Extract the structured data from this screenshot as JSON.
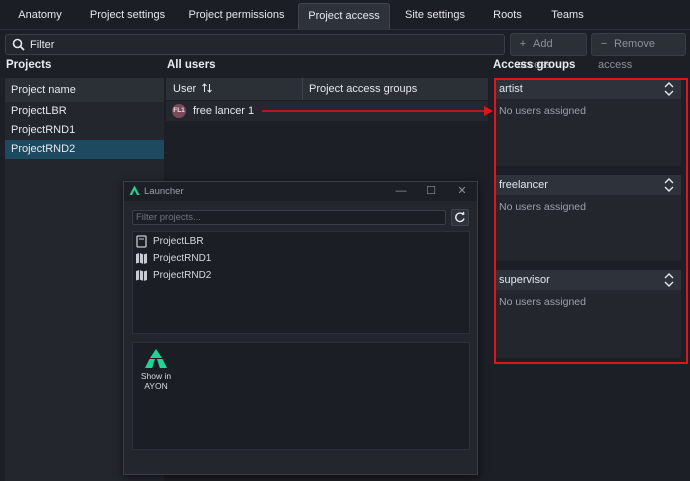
{
  "tabs": [
    {
      "label": "Anatomy"
    },
    {
      "label": "Project settings"
    },
    {
      "label": "Project permissions"
    },
    {
      "label": "Project access",
      "active": true
    },
    {
      "label": "Site settings"
    },
    {
      "label": "Roots"
    },
    {
      "label": "Teams"
    }
  ],
  "filter": {
    "value": "Filter"
  },
  "toolbar": {
    "add_access": "Add access",
    "remove_access": "Remove access"
  },
  "projects": {
    "title": "Projects",
    "column": "Project name",
    "items": [
      "ProjectLBR",
      "ProjectRND1",
      "ProjectRND2"
    ],
    "selected": "ProjectRND2"
  },
  "users": {
    "title": "All users",
    "col_user": "User",
    "col_groups": "Project access groups",
    "rows": [
      {
        "initials": "FL1",
        "name": "free lancer 1"
      }
    ]
  },
  "access_groups": {
    "title": "Access groups",
    "groups": [
      {
        "name": "artist",
        "empty": "No users assigned"
      },
      {
        "name": "freelancer",
        "empty": "No users assigned"
      },
      {
        "name": "supervisor",
        "empty": "No users assigned"
      }
    ]
  },
  "launcher": {
    "title": "Launcher",
    "filter_placeholder": "Filter projects...",
    "projects": [
      "ProjectLBR",
      "ProjectRND1",
      "ProjectRND2"
    ],
    "action": {
      "line1": "Show in",
      "line2": "AYON"
    }
  },
  "colors": {
    "accent": "#1e4a60",
    "highlight": "#e0141b",
    "ayon_green": "#1fd494"
  }
}
